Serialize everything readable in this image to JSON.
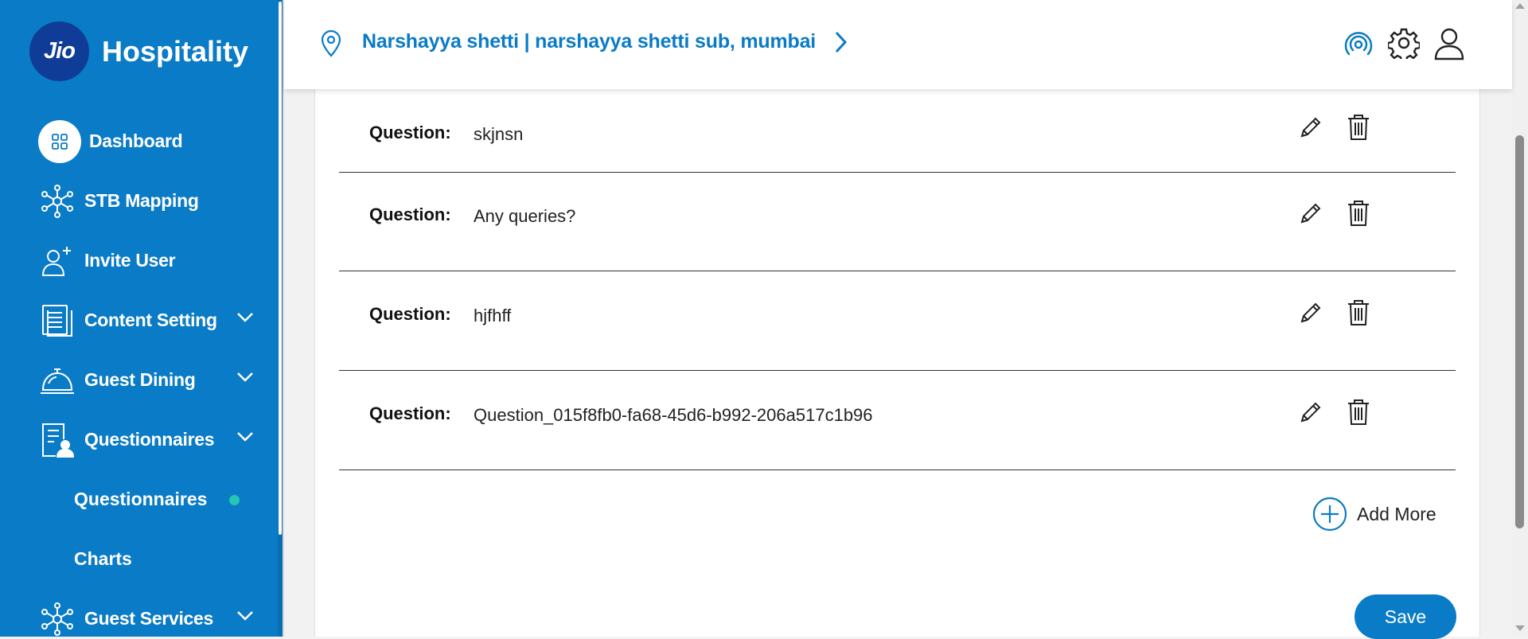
{
  "brand": {
    "logo_text": "Jio",
    "name": "Hospitality"
  },
  "sidebar": {
    "items": [
      {
        "label": "Dashboard",
        "icon": "dashboard-grid-icon"
      },
      {
        "label": "STB Mapping",
        "icon": "network-nodes-icon"
      },
      {
        "label": "Invite User",
        "icon": "user-plus-icon"
      },
      {
        "label": "Content Setting",
        "icon": "document-icon",
        "expandable": true
      },
      {
        "label": "Guest Dining",
        "icon": "cloche-icon",
        "expandable": true
      },
      {
        "label": "Questionnaires",
        "icon": "form-user-icon",
        "expandable": true,
        "expanded": true
      },
      {
        "label": "Guest Services",
        "icon": "network-nodes-icon",
        "expandable": true
      }
    ],
    "sub_items": [
      {
        "label": "Questionnaires",
        "active": true
      },
      {
        "label": "Charts"
      }
    ]
  },
  "header": {
    "location": "Narshayya shetti | narshayya shetti sub, mumbai"
  },
  "questions": {
    "label": "Question:",
    "items": [
      {
        "text": "skjnsn"
      },
      {
        "text": "Any queries?"
      },
      {
        "text": "hjfhff"
      },
      {
        "text": "Question_015f8fb0-fa68-45d6-b992-206a517c1b96"
      }
    ]
  },
  "actions": {
    "add_more": "Add More",
    "save": "Save"
  },
  "colors": {
    "primary": "#0a7bc6",
    "sidebar_bg": "#0a7bc6",
    "active_dot": "#25c6b3",
    "logo_bg": "#0f3c96"
  }
}
